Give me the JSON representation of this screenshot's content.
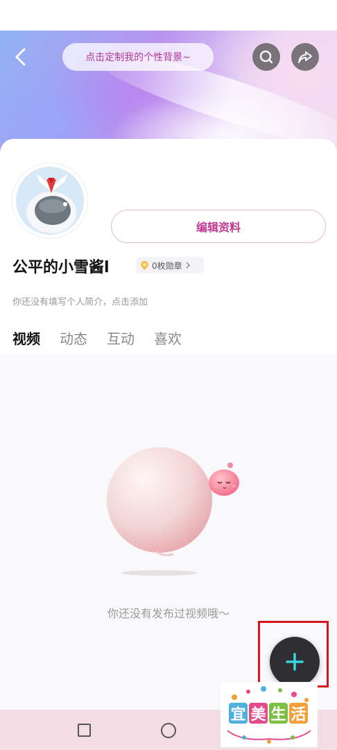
{
  "header": {
    "custom_background_hint": "点击定制我的个性背景~"
  },
  "profile": {
    "username": "公平的小雪酱l",
    "badge": "0枚勋章",
    "bio_placeholder": "你还没有填写个人简介，点击添加",
    "edit_button_label": "编辑资料"
  },
  "tabs": [
    {
      "label": "视频",
      "active": true
    },
    {
      "label": "动态",
      "active": false
    },
    {
      "label": "互动",
      "active": false
    },
    {
      "label": "喜欢",
      "active": false
    }
  ],
  "empty_state": {
    "message": "你还没有发布过视频哦～"
  },
  "fab": {
    "icon": "plus-icon"
  },
  "watermark": {
    "text": "宜美生活"
  },
  "colors": {
    "accent_pink": "#c13a98",
    "fab_dark": "#2f2f33",
    "fab_plus": "#35d6dc",
    "highlight_red": "#d8151b"
  }
}
